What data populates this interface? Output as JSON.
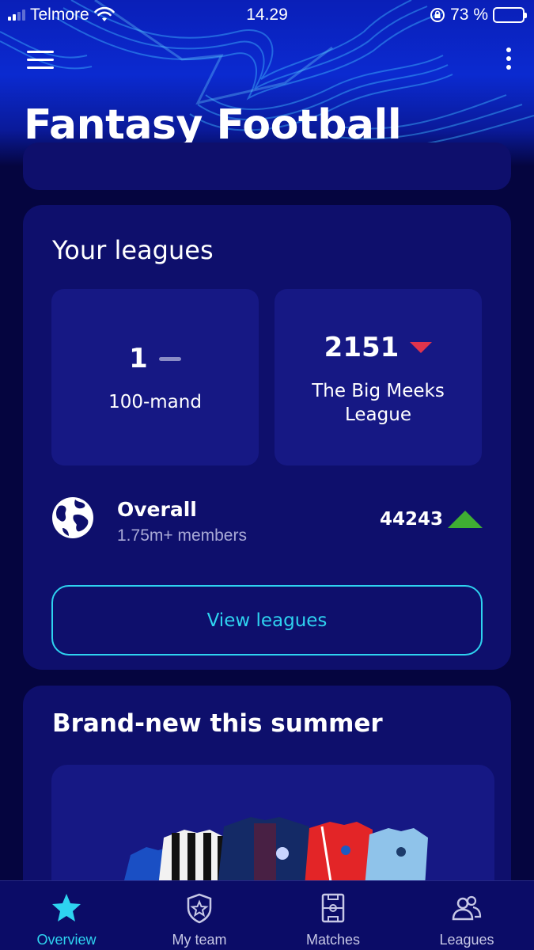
{
  "status_bar": {
    "carrier": "Telmore",
    "time": "14.29",
    "battery": "73 %"
  },
  "header": {
    "title": "Fantasy Football"
  },
  "leagues": {
    "title": "Your leagues",
    "tiles": [
      {
        "rank": "1",
        "trend": "same",
        "name": "100-mand"
      },
      {
        "rank": "2151",
        "trend": "down",
        "name": "The Big Meeks League"
      }
    ],
    "overall": {
      "label": "Overall",
      "members": "1.75m+ members",
      "rank": "44243",
      "trend": "up"
    },
    "view_button": "View leagues"
  },
  "promo": {
    "title": "Brand-new this summer"
  },
  "tabs": [
    {
      "label": "Overview",
      "icon": "star-icon",
      "active": true
    },
    {
      "label": "My team",
      "icon": "shield-star-icon",
      "active": false
    },
    {
      "label": "Matches",
      "icon": "pitch-icon",
      "active": false
    },
    {
      "label": "Leagues",
      "icon": "users-icon",
      "active": false
    }
  ],
  "colors": {
    "accent": "#2ed3f0",
    "down": "#e0344c",
    "up": "#3fae33",
    "card": "#0e0f6c",
    "background": "#05053f"
  }
}
